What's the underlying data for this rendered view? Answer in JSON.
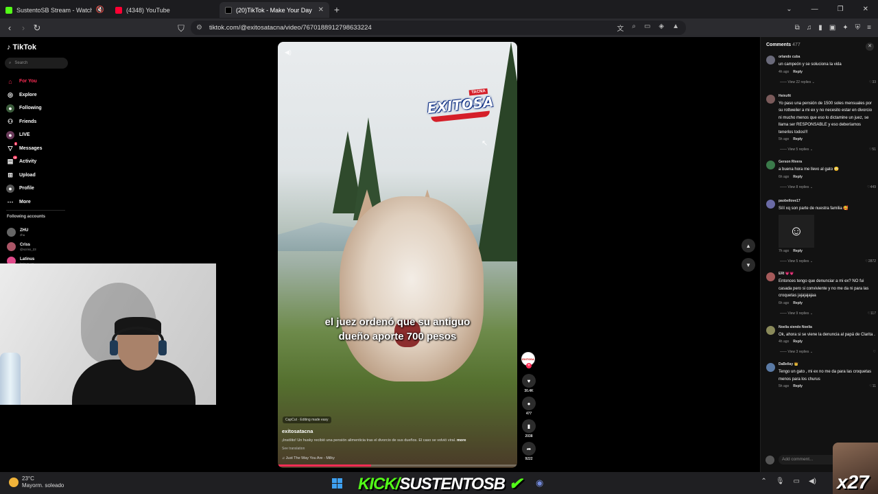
{
  "browser": {
    "tabs": [
      {
        "label": "SustentoSB Stream - Watch Live",
        "favicon_color": "#53fc18"
      },
      {
        "label": "(4348) YouTube",
        "favicon_color": "#ff0033"
      },
      {
        "label": "(20)TikTok - Make Your Day",
        "favicon_color": "#000000"
      }
    ],
    "url": "tiktok.com/@exitosatacna/video/7670188912798633224"
  },
  "tiktok": {
    "brand": "TikTok",
    "search_placeholder": "Search",
    "nav": [
      {
        "label": "For You",
        "icon": "home-icon",
        "active": true
      },
      {
        "label": "Explore",
        "icon": "compass-icon"
      },
      {
        "label": "Following",
        "icon": "following-icon"
      },
      {
        "label": "Friends",
        "icon": "friends-icon"
      },
      {
        "label": "LIVE",
        "icon": "live-icon"
      },
      {
        "label": "Messages",
        "icon": "messages-icon",
        "badge": "6"
      },
      {
        "label": "Activity",
        "icon": "activity-icon",
        "badge": "16"
      },
      {
        "label": "Upload",
        "icon": "upload-icon"
      },
      {
        "label": "Profile",
        "icon": "profile-icon"
      },
      {
        "label": "More",
        "icon": "more-icon"
      }
    ],
    "following_header": "Following accounts",
    "following": [
      {
        "name": "ZHU",
        "sub": "zhu"
      },
      {
        "name": "Criss",
        "sub": "@scriss_23"
      },
      {
        "name": "Latinus",
        "sub": "latinus_us"
      }
    ]
  },
  "video": {
    "logo_tag": "TACNA",
    "logo_text": "EXITOSA",
    "caption_line1": "el juez ordenó que su antiguo",
    "caption_line2": "dueño aporte 700 pesos",
    "capcut": "CapCut · Editing made easy",
    "author": "exitosatacna",
    "description": "¡Insólito! Un husky recibió una pensión alimenticia tras el divorcio de sus dueños. El caso se volvió viral.",
    "more": "more",
    "see_translation": "See translation",
    "song": "Just The Way You Are - Milky",
    "progress": 0.39,
    "actions": {
      "likes": "30.4K",
      "comments": "477",
      "saves": "2038",
      "shares": "9222"
    }
  },
  "comments": {
    "title": "Comments",
    "count": "477",
    "add_placeholder": "Add comment...",
    "reply_label": "Reply",
    "items": [
      {
        "user": "orlando cuba",
        "text": "un campeón y se soluciona la vida",
        "time": "4h ago",
        "likes": "33",
        "view": "View 22 replies"
      },
      {
        "user": "Heinzfit",
        "text": "Yo paso una pensión de 1500 soles mensuales por su rottweiler a mi ex y no necesito estar en divorcio ni mucho menos que eso lo dictamine un juez, se llama ser RESPONSABLE y eso deberíamos tenerlos todos!!!",
        "time": "5h ago",
        "likes": "51",
        "view": "View 5 replies"
      },
      {
        "user": "Gerson Rivera",
        "text": "a buena hora me llevo al gato 😳",
        "time": "6h ago",
        "likes": "449",
        "view": "View 8 replies"
      },
      {
        "user": "paobellove17",
        "text": "Sííí xq son parte de nuestra familia 🥰",
        "time": "7h ago",
        "likes": "2872",
        "view": "View 5 replies",
        "sticker": true
      },
      {
        "user": "ERI 💗💗",
        "text": "Entonces tengo que denunciar a mi ex? NO fui casada pero si conviviente y no me da ni para las croquetas jajajajajaa",
        "time": "6h ago",
        "likes": "117",
        "view": "View 9 replies"
      },
      {
        "user": "Noelia siendo Noelia",
        "text": "Ok, ahora si se viene la denuncia al papá de Clarita .",
        "time": "4h ago",
        "likes": "",
        "view": "View 3 replies"
      },
      {
        "user": "DaBellay 👑",
        "text": "Tengo un gato , mi ex no me da para las croquetas menos para los churus",
        "time": "5h ago",
        "likes": "11",
        "view": ""
      }
    ]
  },
  "stream": {
    "kick_prefix": "KICK/",
    "kick_name": "SUSTENTOSB",
    "counter": "x27"
  },
  "taskbar": {
    "temperature": "23°C",
    "weather": "Mayorm. soleado"
  }
}
